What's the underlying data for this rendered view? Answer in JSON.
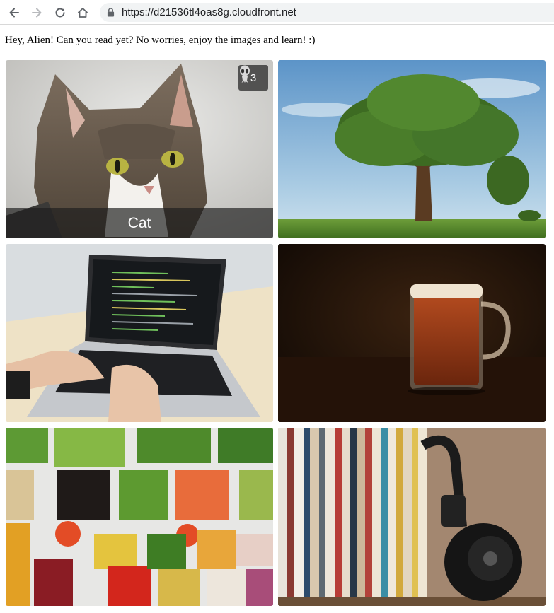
{
  "browser": {
    "url": "https://d21536tl4oas8g.cloudfront.net",
    "back_icon": "arrow-left-icon",
    "forward_icon": "arrow-right-icon",
    "reload_icon": "reload-icon",
    "home_icon": "home-icon",
    "lock_icon": "lock-icon"
  },
  "intro_text": "Hey, Alien! Can you read yet? No worries, enjoy the images and learn! :)",
  "gallery": {
    "tiles": [
      {
        "subject": "cat",
        "caption": "Cat",
        "badge_count": "3",
        "badge_icon": "alien-icon"
      },
      {
        "subject": "tree"
      },
      {
        "subject": "laptop"
      },
      {
        "subject": "beer"
      },
      {
        "subject": "vegetables"
      },
      {
        "subject": "records"
      }
    ]
  },
  "colors": {
    "chrome_bg": "#ffffff",
    "omnibox_bg": "#f1f3f4",
    "caption_overlay": "rgba(30,30,30,0.68)"
  }
}
